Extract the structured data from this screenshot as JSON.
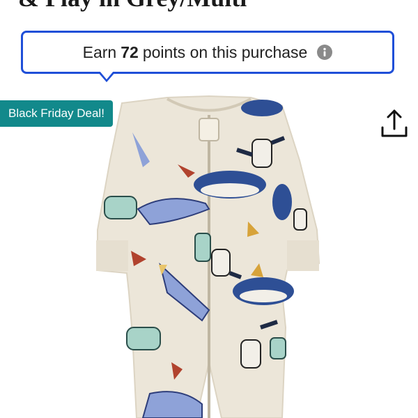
{
  "product": {
    "title_fragment": "& Play in Grey/Multi"
  },
  "points_banner": {
    "prefix": "Earn",
    "points": "72",
    "suffix": "points on this purchase",
    "accent_color": "#1f4fd8"
  },
  "badge": {
    "label": "Black Friday Deal!",
    "color": "#12898b"
  },
  "icons": {
    "info": "info-icon",
    "share": "share-icon"
  }
}
